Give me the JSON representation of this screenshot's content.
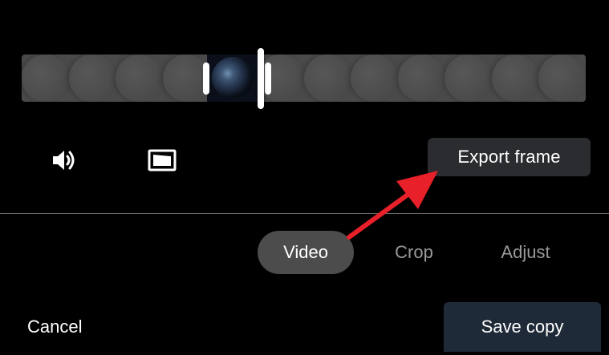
{
  "timeline": {
    "thumbnail_count": 12,
    "selected_frame": "earth-thumbnail"
  },
  "toolbar": {
    "volume_icon": "volume-icon",
    "aspect_icon": "aspect-ratio-icon",
    "export_label": "Export frame"
  },
  "tabs": [
    {
      "label": "Video",
      "active": true
    },
    {
      "label": "Crop",
      "active": false
    },
    {
      "label": "Adjust",
      "active": false
    }
  ],
  "actions": {
    "cancel_label": "Cancel",
    "save_label": "Save copy"
  },
  "colors": {
    "background": "#000000",
    "timeline": "#4a4a4a",
    "export_button": "#2b2c30",
    "active_tab": "#4c4c4c",
    "save_button": "#1f2a38",
    "annotation_arrow": "#e8202a",
    "inactive_tab_text": "#9a9a9a"
  }
}
